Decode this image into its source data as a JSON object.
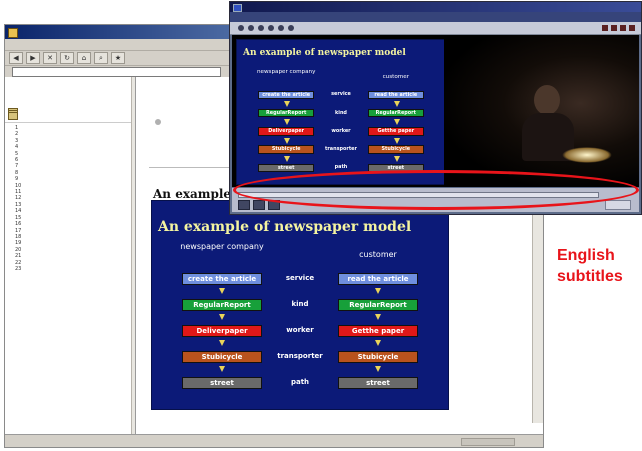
{
  "browser": {
    "title": "",
    "menu": [
      "",
      "",
      "",
      "",
      "",
      ""
    ],
    "toolbar_label": "",
    "address_label": "",
    "url": "",
    "sidebar": {
      "links": [
        "",
        "",
        ""
      ],
      "heading": "",
      "toc": [
        {
          "num": "1",
          "text": ""
        },
        {
          "num": "2",
          "text": ""
        },
        {
          "num": "3",
          "text": ""
        },
        {
          "num": "4",
          "text": ""
        },
        {
          "num": "5",
          "text": ""
        },
        {
          "num": "6",
          "text": ""
        },
        {
          "num": "7",
          "text": ""
        },
        {
          "num": "8",
          "text": ""
        },
        {
          "num": "9",
          "text": ""
        },
        {
          "num": "10",
          "text": ""
        },
        {
          "num": "11",
          "text": ""
        },
        {
          "num": "12",
          "text": ""
        },
        {
          "num": "13",
          "text": ""
        },
        {
          "num": "14",
          "text": ""
        },
        {
          "num": "15",
          "text": ""
        },
        {
          "num": "16",
          "text": ""
        },
        {
          "num": "17",
          "text": ""
        },
        {
          "num": "18",
          "text": ""
        },
        {
          "num": "19",
          "text": ""
        },
        {
          "num": "20",
          "text": ""
        },
        {
          "num": "21",
          "text": ""
        },
        {
          "num": "22",
          "text": ""
        },
        {
          "num": "23",
          "text": ""
        }
      ]
    },
    "content": {
      "nav_link": "",
      "nav_items": [
        "",
        ""
      ],
      "page_title": "An example of newspaper model"
    },
    "status_text": "",
    "zone_text": ""
  },
  "slide": {
    "title": "An example of newspaper model",
    "left_header": "newspaper company",
    "right_header": "customer",
    "rows": [
      {
        "left": "create the article",
        "middle": "service",
        "right": "read the article",
        "color": "#6f8fde"
      },
      {
        "left": "RegularReport",
        "middle": "kind",
        "right": "RegularReport",
        "color": "#17a03a"
      },
      {
        "left": "Deliverpaper",
        "middle": "worker",
        "right": "Getthe paper",
        "color": "#e01818"
      },
      {
        "left": "Stubicycle",
        "middle": "transporter",
        "right": "Stubicycle",
        "color": "#b9531d"
      },
      {
        "left": "street",
        "middle": "path",
        "right": "street",
        "color": "#6a6a6a"
      }
    ],
    "footer_left": "",
    "footer_mid": "",
    "footer_right": ""
  },
  "player": {
    "title": "",
    "menu": [
      "",
      "",
      "",
      "",
      "",
      "",
      "",
      ""
    ],
    "subtitle": ""
  },
  "annotation": {
    "line1": "English",
    "line2": "subtitles",
    "color": "#e8141a"
  }
}
